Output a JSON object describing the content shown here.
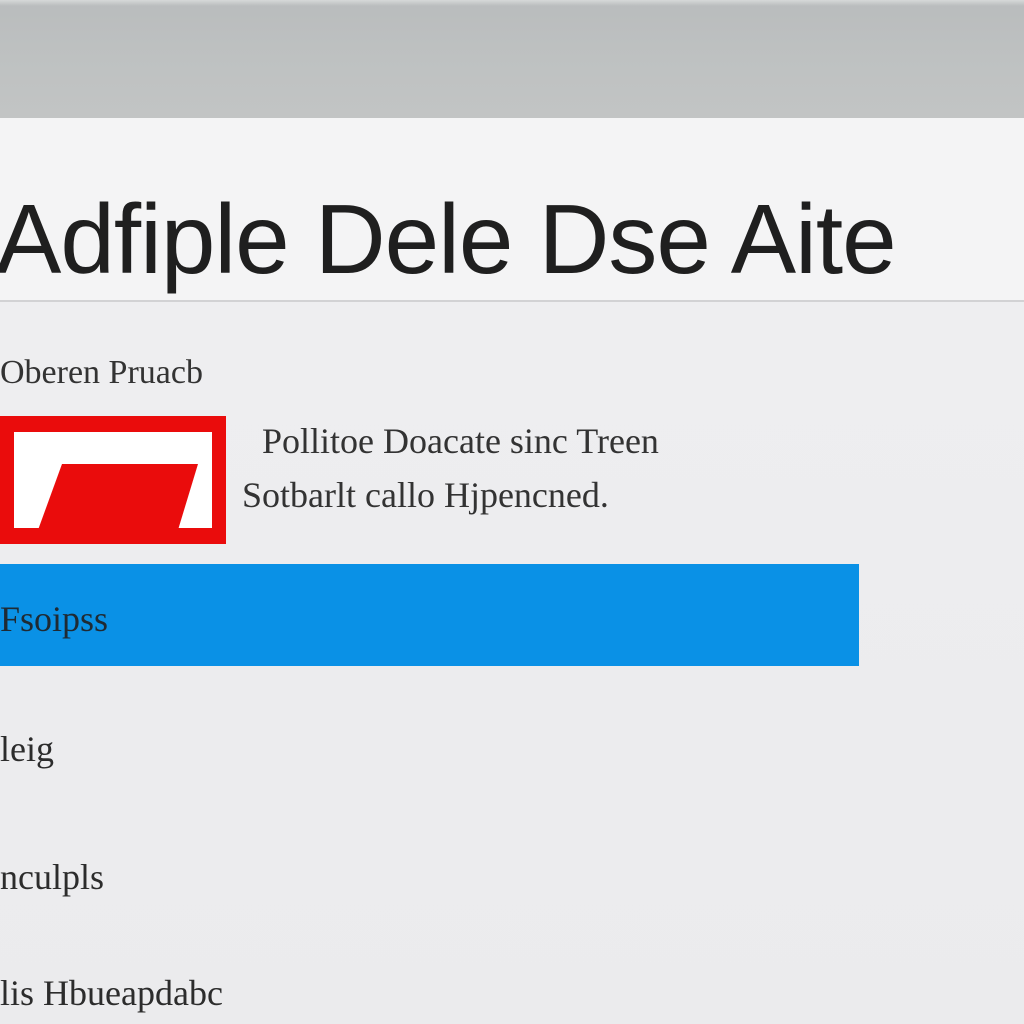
{
  "window": {
    "title": "Adfiple Dele Dse Aite"
  },
  "section": {
    "label": "Oberen Pruacb"
  },
  "app": {
    "logo_icon": "red-white-parallelogram-logo-icon",
    "logo_color": "#ea0c0c",
    "description_line1": "Pollitoe Doacate sinc Treen",
    "description_line2": "Sotbarlt callo Hjpencned."
  },
  "menu": {
    "selected_label": "Fsoipss",
    "selected_color": "#0a91e6",
    "items": [
      "leig",
      "nculpls",
      "lis Hbueapdabc"
    ]
  }
}
